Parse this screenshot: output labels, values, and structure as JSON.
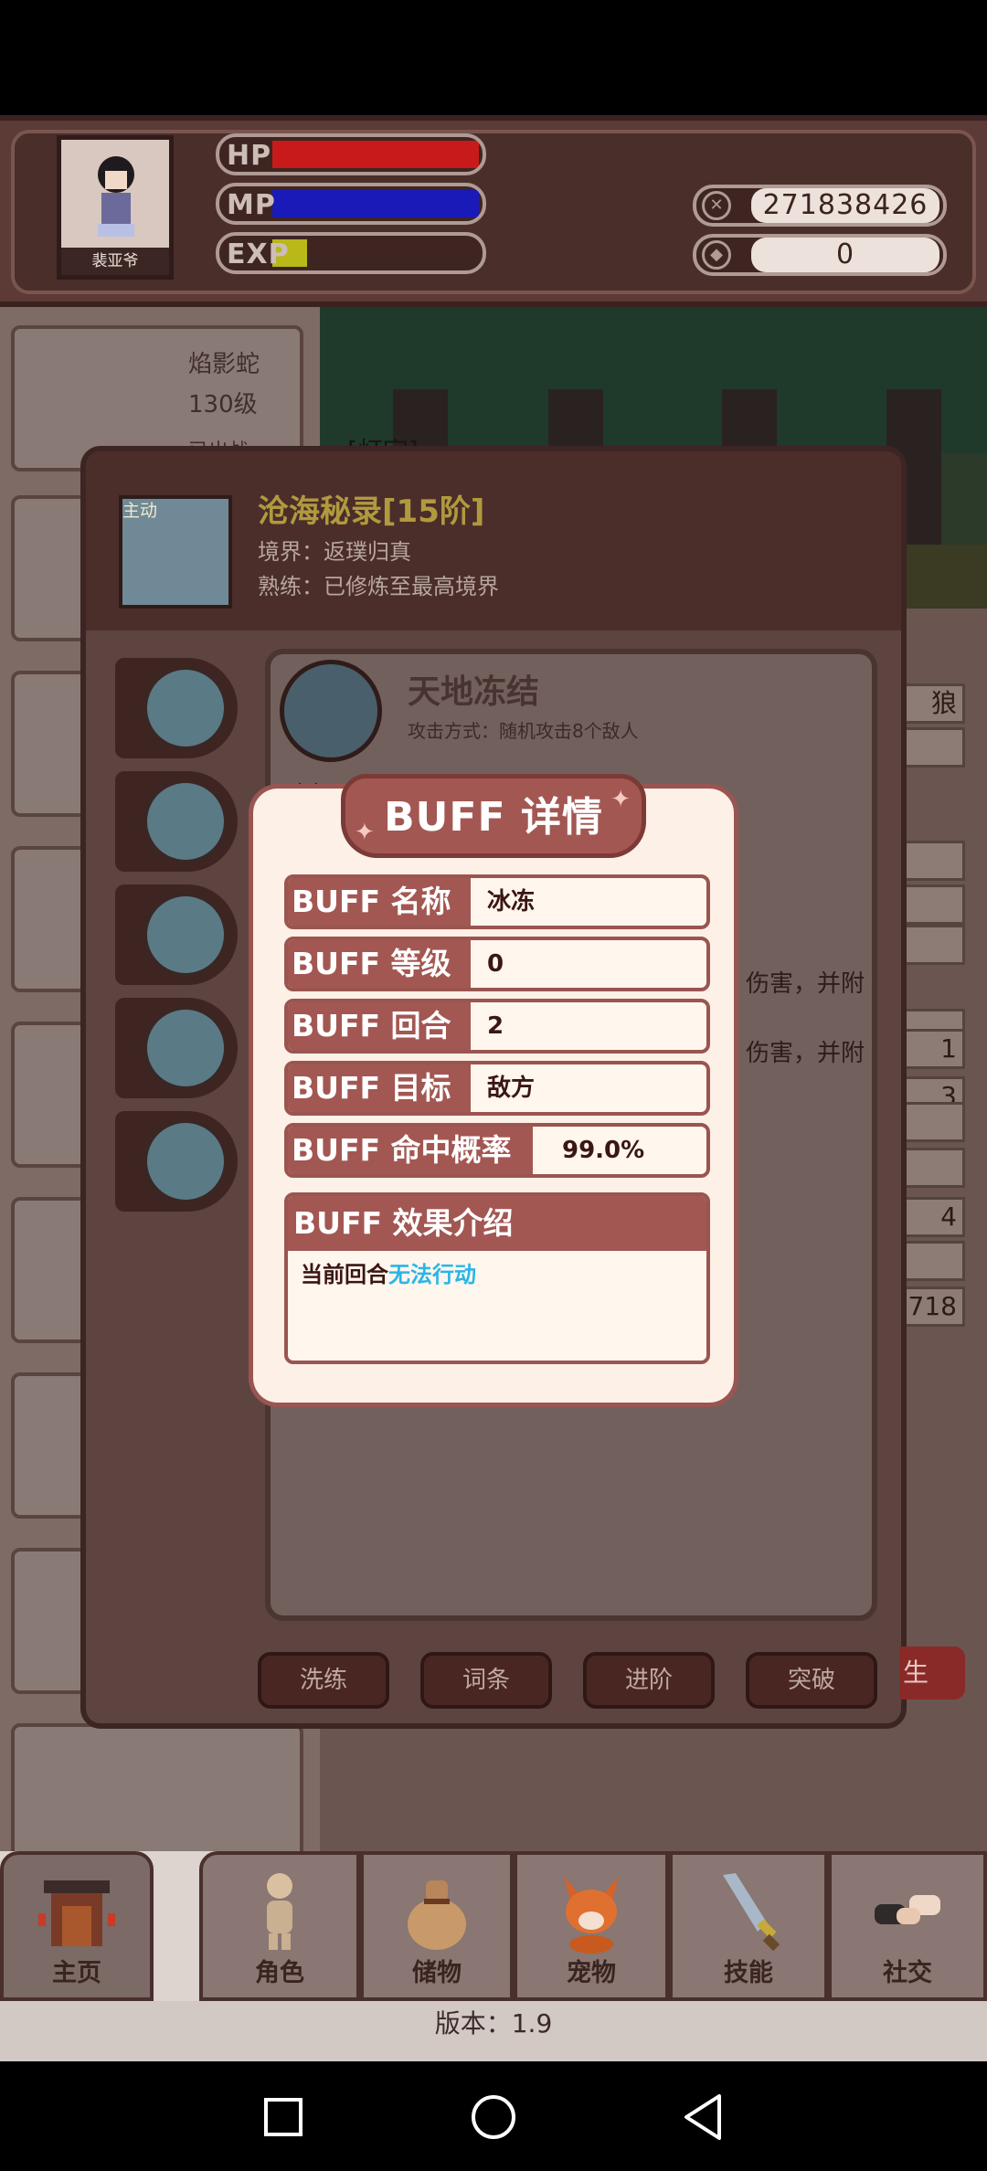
{
  "player": {
    "name": "裴亚爷"
  },
  "stats": {
    "hp_label": "HP",
    "mp_label": "MP",
    "exp_label": "EXP",
    "hp_color": "#c81a1a",
    "mp_color": "#1a1ab8",
    "exp_color": "#b8b81a",
    "exp_fraction": 0.17
  },
  "currency": {
    "coins": "271838426",
    "gems": "0"
  },
  "background_cards": {
    "pet_name": "焰影蛇",
    "pet_level": "130级",
    "pet_status": "已出战",
    "right_col": [
      "狼",
      "",
      "",
      "",
      "",
      "",
      "1",
      "3",
      "",
      "",
      "4",
      "",
      "718"
    ],
    "forest_text": "[灯宇]"
  },
  "skill_panel": {
    "active_tag": "主动",
    "title": "沧海秘录[15阶]",
    "realm": "境界：返璞归真",
    "mastery": "熟练：已修炼至最高境界",
    "skill_name": "天地冻结",
    "attack_mode": "攻击方式：随机攻击8个敌人",
    "cooldown_partial": "冷却",
    "partial_line_1": "伤害，并附",
    "partial_line_2": "伤害，并附",
    "buttons": [
      "洗练",
      "词条",
      "进阶",
      "突破"
    ],
    "side_button": "生"
  },
  "buff_dialog": {
    "title": "BUFF 详情",
    "rows": [
      {
        "key": "BUFF 名称",
        "value": "冰冻"
      },
      {
        "key": "BUFF 等级",
        "value": "0"
      },
      {
        "key": "BUFF 回合",
        "value": "2"
      },
      {
        "key": "BUFF 目标",
        "value": "敌方"
      },
      {
        "key": "BUFF 命中概率",
        "value": "99.0%"
      }
    ],
    "effect_heading": "BUFF 效果介绍",
    "effect_prefix": "当前回合",
    "effect_highlight": "无法行动",
    "accent_color": "#a35752",
    "highlight_color": "#29b6e6"
  },
  "bottom_nav": {
    "items": [
      {
        "label": "主页",
        "icon": "home-gate-icon"
      },
      {
        "label": "角色",
        "icon": "character-figure-icon"
      },
      {
        "label": "储物",
        "icon": "bag-icon"
      },
      {
        "label": "宠物",
        "icon": "fox-pet-icon"
      },
      {
        "label": "技能",
        "icon": "sword-icon"
      },
      {
        "label": "社交",
        "icon": "handshake-icon"
      }
    ]
  },
  "version_text": "版本：1.9",
  "system_nav": {
    "icons": [
      "recent-apps-icon",
      "home-icon",
      "back-icon"
    ]
  }
}
